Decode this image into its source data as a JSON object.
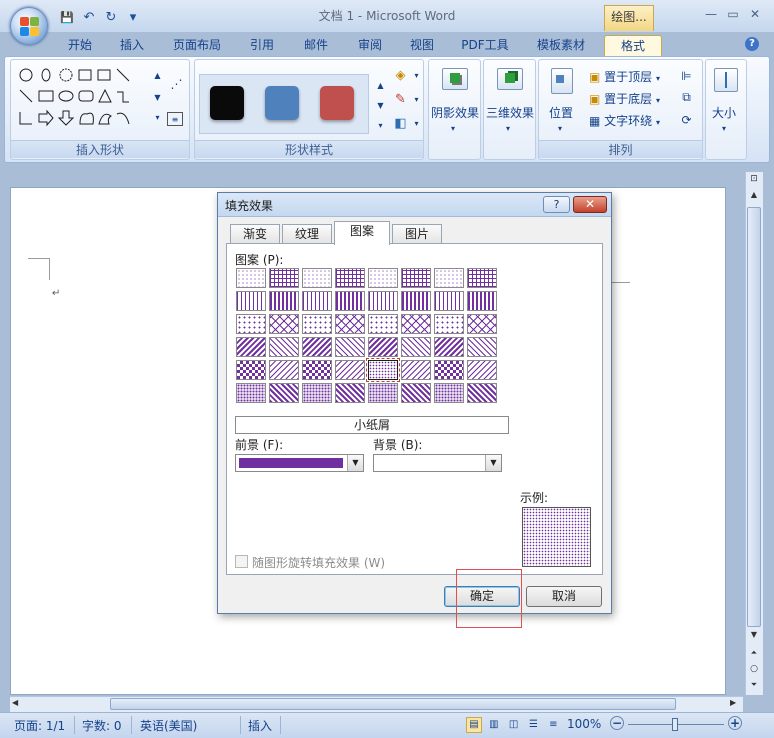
{
  "window": {
    "title": "文档 1 - Microsoft Word",
    "contextual_tab_title": "绘图...",
    "minimize": "—",
    "maximize": "▭",
    "close": "✕"
  },
  "quick_access": {
    "save": "💾",
    "undo": "↶",
    "redo": "↻",
    "dropdown": "▾"
  },
  "tabs": [
    "开始",
    "插入",
    "页面布局",
    "引用",
    "邮件",
    "审阅",
    "视图",
    "PDF工具",
    "模板素材",
    "格式"
  ],
  "active_tab": "格式",
  "help": "?",
  "ribbon": {
    "insert_shapes": {
      "label": "插入形状"
    },
    "shape_styles": {
      "label": "形状样式",
      "swatches": [
        "#0a0a0a",
        "#4f81bd",
        "#c0504d"
      ]
    },
    "shadow_effects": {
      "label": "阴影效果"
    },
    "effects_3d": {
      "label": "三维效果"
    },
    "arrange": {
      "label": "排列",
      "position": "位置",
      "bring_to_front": "置于顶层",
      "send_to_back": "置于底层",
      "text_wrap": "文字环绕"
    },
    "size": {
      "label": "大小"
    }
  },
  "dialog": {
    "title": "填充效果",
    "help_btn": "?",
    "close_btn": "✕",
    "tabs": [
      "渐变",
      "纹理",
      "图案",
      "图片"
    ],
    "active_tab": "图案",
    "pattern_label": "图案 (P):",
    "selected_pattern_name": "小纸屑",
    "foreground_label": "前景 (F):",
    "background_label": "背景 (B):",
    "foreground_color": "#7030a0",
    "background_color": "#ffffff",
    "sample_label": "示例:",
    "rotate_label": "随图形旋转填充效果 (W)",
    "ok": "确定",
    "cancel": "取消"
  },
  "statusbar": {
    "page": "页面: 1/1",
    "words": "字数: 0",
    "language": "英语(美国)",
    "mode": "插入",
    "zoom": "100%",
    "zoom_minus": "−",
    "zoom_plus": "+"
  },
  "document": {
    "para_mark": "↵"
  }
}
